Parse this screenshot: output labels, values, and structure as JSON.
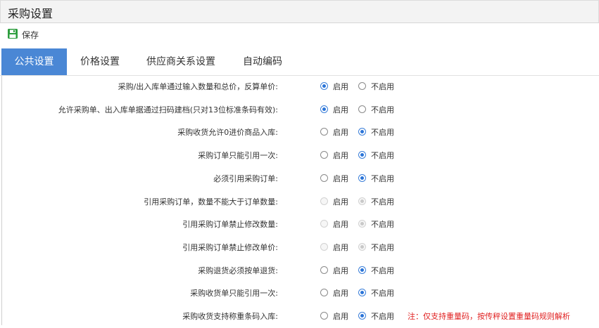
{
  "window": {
    "title": "采购设置"
  },
  "toolbar": {
    "save_label": "保存",
    "save_icon": "save-disk-icon",
    "save_color": "#2e9e3f"
  },
  "tabs": [
    {
      "label": "公共设置",
      "active": true
    },
    {
      "label": "价格设置",
      "active": false
    },
    {
      "label": "供应商关系设置",
      "active": false
    },
    {
      "label": "自动编码",
      "active": false
    }
  ],
  "colors": {
    "accent": "#4a87d5",
    "note": "#e02020"
  },
  "options": {
    "enable": "启用",
    "disable": "不启用"
  },
  "settings": [
    {
      "label": "采购/出入库单通过输入数量和总价，反算单价:",
      "value": "enable",
      "disabled": false
    },
    {
      "label": "允许采购单、出入库单据通过扫码建档(只对13位标准条码有效):",
      "value": "enable",
      "disabled": false
    },
    {
      "label": "采购收货允许0进价商品入库:",
      "value": "disable",
      "disabled": false
    },
    {
      "label": "采购订单只能引用一次:",
      "value": "disable",
      "disabled": false
    },
    {
      "label": "必须引用采购订单:",
      "value": "disable",
      "disabled": false
    },
    {
      "label": "引用采购订单，数量不能大于订单数量:",
      "value": "disable",
      "disabled": true
    },
    {
      "label": "引用采购订单禁止修改数量:",
      "value": "disable",
      "disabled": true
    },
    {
      "label": "引用采购订单禁止修改单价:",
      "value": "disable",
      "disabled": true
    },
    {
      "label": "采购退货必须按单退货:",
      "value": "disable",
      "disabled": false
    },
    {
      "label": "采购收货单只能引用一次:",
      "value": "disable",
      "disabled": false
    },
    {
      "label": "采购收货支持称重条码入库:",
      "value": "disable",
      "disabled": false,
      "note": "注：仅支持重量码，按传秤设置重量码规则解析"
    }
  ]
}
